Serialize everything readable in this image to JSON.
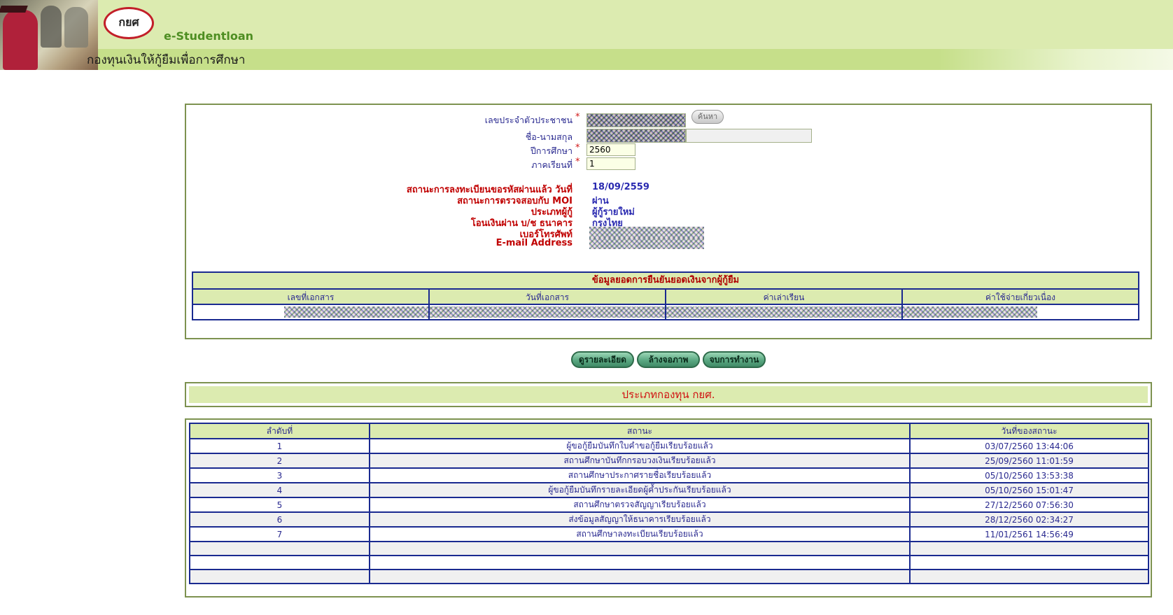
{
  "header": {
    "brand": "e-Studentloan",
    "title": "กองทุนเงินให้กู้ยืมเพื่อการศึกษา",
    "logo_text": "กยศ"
  },
  "form": {
    "citizen_id_label": "เลขประจำตัวประชาชน",
    "name_label": "ชื่อ-นามสกุล",
    "year_label": "ปีการศึกษา",
    "year_value": "2560",
    "semester_label": "ภาคเรียนที่",
    "semester_value": "1",
    "search_button": "ค้นหา",
    "required_mark": "*"
  },
  "info": {
    "labels": [
      "สถานะการลงทะเบียนขอรหัสผ่านแล้ว วันที่",
      "สถานะการตรวจสอบกับ MOI",
      "ประเภทผู้กู้",
      "โอนเงินผ่าน บ/ช ธนาคาร",
      "เบอร์โทรศัพท์",
      "E-mail Address"
    ],
    "values": [
      "18/09/2559",
      "ผ่าน",
      "ผู้กู้รายใหม่",
      "กรุงไทย",
      "",
      ""
    ]
  },
  "confirm_table": {
    "title": "ข้อมูลยอดการยืนยันยอดเงินจากผู้กู้ยืม",
    "headers": [
      "เลขที่เอกสาร",
      "วันที่เอกสาร",
      "ค่าเล่าเรียน",
      "ค่าใช้จ่ายเกี่ยวเนื่อง"
    ]
  },
  "actions": {
    "detail": "ดูรายละเอียด",
    "clear": "ล้างจอภาพ",
    "finish": "จบการทำงาน"
  },
  "fund_type": "ประเภทกองทุน  กยศ.",
  "status_table": {
    "headers": [
      "ลำดับที่",
      "สถานะ",
      "วันที่ของสถานะ"
    ],
    "rows": [
      [
        "1",
        "ผู้ขอกู้ยืมบันทึกใบคำขอกู้ยืมเรียบร้อยแล้ว",
        "03/07/2560 13:44:06"
      ],
      [
        "2",
        "สถานศึกษาบันทึกกรอบวงเงินเรียบร้อยแล้ว",
        "25/09/2560 11:01:59"
      ],
      [
        "3",
        "สถานศึกษาประกาศรายชื่อเรียบร้อยแล้ว",
        "05/10/2560 13:53:38"
      ],
      [
        "4",
        "ผู้ขอกู้ยืมบันทึกรายละเอียดผู้ค้ำประกันเรียบร้อยแล้ว",
        "05/10/2560 15:01:47"
      ],
      [
        "5",
        "สถานศึกษาตรวจสัญญาเรียบร้อยแล้ว",
        "27/12/2560 07:56:30"
      ],
      [
        "6",
        "ส่งข้อมูลสัญญาให้ธนาคารเรียบร้อยแล้ว",
        "28/12/2560 02:34:27"
      ],
      [
        "7",
        "สถานศึกษาลงทะเบียนเรียบร้อยแล้ว",
        "11/01/2561 14:56:49"
      ],
      [
        "",
        "",
        ""
      ],
      [
        "",
        "",
        ""
      ],
      [
        "",
        "",
        ""
      ]
    ]
  },
  "colors": {
    "header_bg": "#dcebb0",
    "table_border": "#1a2a90",
    "label_red": "#c00000",
    "value_blue": "#2a2ab0"
  }
}
